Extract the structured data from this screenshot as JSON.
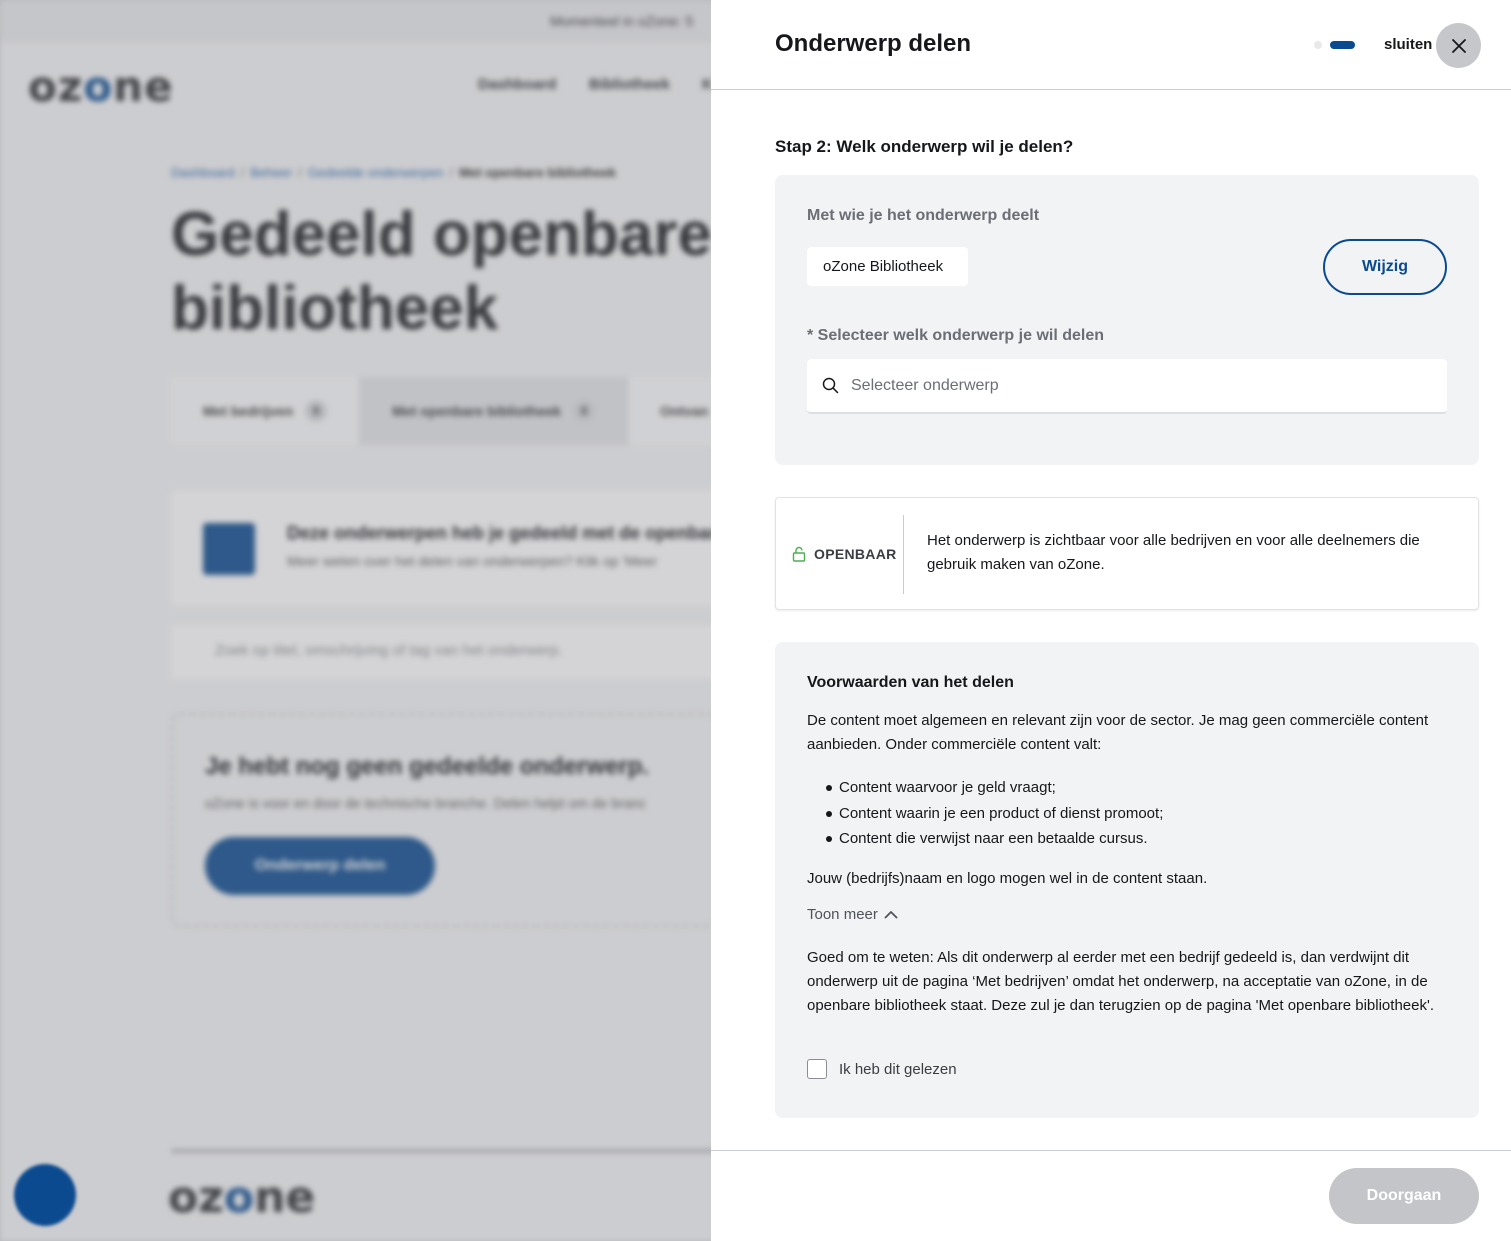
{
  "background": {
    "banner_text": "Momenteel in oZone: 5",
    "logo": "ozone",
    "nav": [
      "Dashboard",
      "Bibliotheek",
      "K"
    ],
    "breadcrumb": [
      "Dashboard",
      "Beheer",
      "Gedeelde onderwerpen",
      "Met openbare bibliotheek"
    ],
    "page_title": "Gedeeld openbare bibliotheek",
    "tabs": [
      {
        "label": "Met bedrijven",
        "count": "0"
      },
      {
        "label": "Met openbare bibliotheek",
        "count": "0"
      },
      {
        "label": "Ontvan"
      }
    ],
    "info_title": "Deze onderwerpen heb je gedeeld met de openbare",
    "info_sub": "Meer weten over het delen van onderwerpen? Klik op 'Meer",
    "search_placeholder": "Zoek op titel, omschrijving of tag van het onderwerp.",
    "empty_title": "Je hebt nog geen gedeelde onderwerp.",
    "empty_sub": "oZone is voor en door de technische branche. Delen helpt om de branc",
    "empty_button": "Onderwerp delen",
    "footer_logo": "ozone"
  },
  "drawer": {
    "title": "Onderwerp delen",
    "close_label": "sluiten",
    "step_heading": "Stap 2: Welk onderwerp wil je delen?",
    "share_with": {
      "label": "Met wie je het onderwerp deelt",
      "value": "oZone Bibliotheek",
      "change_button": "Wijzig"
    },
    "select": {
      "label": "* Selecteer welk onderwerp je wil delen",
      "placeholder": "Selecteer onderwerp"
    },
    "visibility": {
      "label": "OPENBAAR",
      "text": "Het onderwerp is zichtbaar voor alle bedrijven en voor alle deelnemers die gebruik maken van oZone."
    },
    "conditions": {
      "title": "Voorwaarden van het delen",
      "intro": "De content moet algemeen en relevant zijn voor de sector. Je mag geen commerciële content aanbieden. Onder commerciële content valt:",
      "items": [
        "Content waarvoor je geld vraagt;",
        "Content waarin je een product of dienst promoot;",
        "Content die verwijst naar een betaalde cursus."
      ],
      "note": "Jouw (bedrijfs)naam en logo mogen wel in de content staan.",
      "toggle_label": "Toon meer",
      "more_text": "Goed om te weten: Als dit onderwerp al eerder met een bedrijf gedeeld is, dan verdwijnt dit onderwerp uit de pagina ‘Met bedrijven’ omdat het onderwerp, na acceptatie van oZone, in de openbare bibliotheek staat. Deze zul je dan terugzien op de pagina 'Met openbare bibliotheek'.",
      "checkbox_label": "Ik heb dit gelezen"
    },
    "continue_button": "Doorgaan"
  },
  "colors": {
    "brand_blue": "#0b4a8f",
    "panel_gray": "#f2f3f5",
    "disabled_button": "#c3c5c9",
    "open_green": "#4caf50"
  }
}
